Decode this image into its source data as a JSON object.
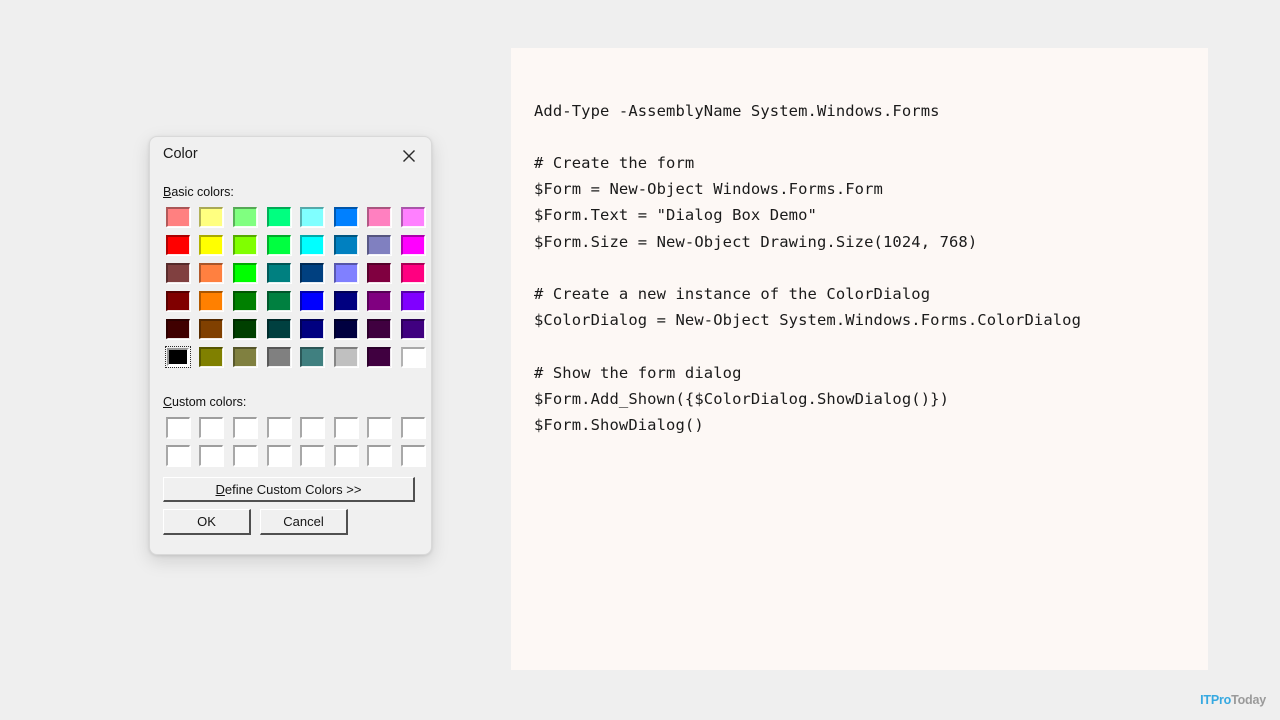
{
  "page": {
    "background_color": "#efefef"
  },
  "brand": {
    "primary_text": "ITPro",
    "secondary_text": "Today",
    "primary_color": "#36a9e1",
    "secondary_color": "#9a9a9a"
  },
  "code_panel": {
    "background_color": "#fdf8f5",
    "language": "powershell",
    "code": "Add-Type -AssemblyName System.Windows.Forms\n\n# Create the form\n$Form = New-Object Windows.Forms.Form\n$Form.Text = \"Dialog Box Demo\"\n$Form.Size = New-Object Drawing.Size(1024, 768)\n\n# Create a new instance of the ColorDialog\n$ColorDialog = New-Object System.Windows.Forms.ColorDialog\n\n# Show the form dialog\n$Form.Add_Shown({$ColorDialog.ShowDialog()})\n$Form.ShowDialog()",
    "lines": [
      "Add-Type -AssemblyName System.Windows.Forms",
      "",
      "# Create the form",
      "$Form = New-Object Windows.Forms.Form",
      "$Form.Text = \"Dialog Box Demo\"",
      "$Form.Size = New-Object Drawing.Size(1024, 768)",
      "",
      "# Create a new instance of the ColorDialog",
      "$ColorDialog = New-Object System.Windows.Forms.ColorDialog",
      "",
      "# Show the form dialog",
      "$Form.Add_Shown({$ColorDialog.ShowDialog()})",
      "$Form.ShowDialog()"
    ]
  },
  "dialog": {
    "title": "Color",
    "close_icon": "close-icon",
    "basic_colors_label_accel": "B",
    "basic_colors_label_rest": "asic colors:",
    "custom_colors_label_accel": "C",
    "custom_colors_label_rest": "ustom colors:",
    "define_custom_accel": "D",
    "define_custom_rest": "efine Custom Colors >>",
    "ok_label": "OK",
    "cancel_label": "Cancel",
    "selected_swatch_index": 40,
    "basic_colors": [
      "#ff8080",
      "#ffff80",
      "#80ff80",
      "#00ff80",
      "#80ffff",
      "#0080ff",
      "#ff80c0",
      "#ff80ff",
      "#ff0000",
      "#ffff00",
      "#80ff00",
      "#00ff40",
      "#00ffff",
      "#0080c0",
      "#8080c0",
      "#ff00ff",
      "#804040",
      "#ff8040",
      "#00ff00",
      "#008080",
      "#004080",
      "#8080ff",
      "#800040",
      "#ff0080",
      "#800000",
      "#ff8000",
      "#008000",
      "#008040",
      "#0000ff",
      "#000080",
      "#800080",
      "#8000ff",
      "#400000",
      "#804000",
      "#004000",
      "#004040",
      "#000080",
      "#000040",
      "#400040",
      "#400080",
      "#000000",
      "#808000",
      "#808040",
      "#808080",
      "#408080",
      "#c0c0c0",
      "#400040",
      "#ffffff"
    ],
    "custom_colors": [
      "#ffffff",
      "#ffffff",
      "#ffffff",
      "#ffffff",
      "#ffffff",
      "#ffffff",
      "#ffffff",
      "#ffffff",
      "#ffffff",
      "#ffffff",
      "#ffffff",
      "#ffffff",
      "#ffffff",
      "#ffffff",
      "#ffffff",
      "#ffffff"
    ]
  }
}
